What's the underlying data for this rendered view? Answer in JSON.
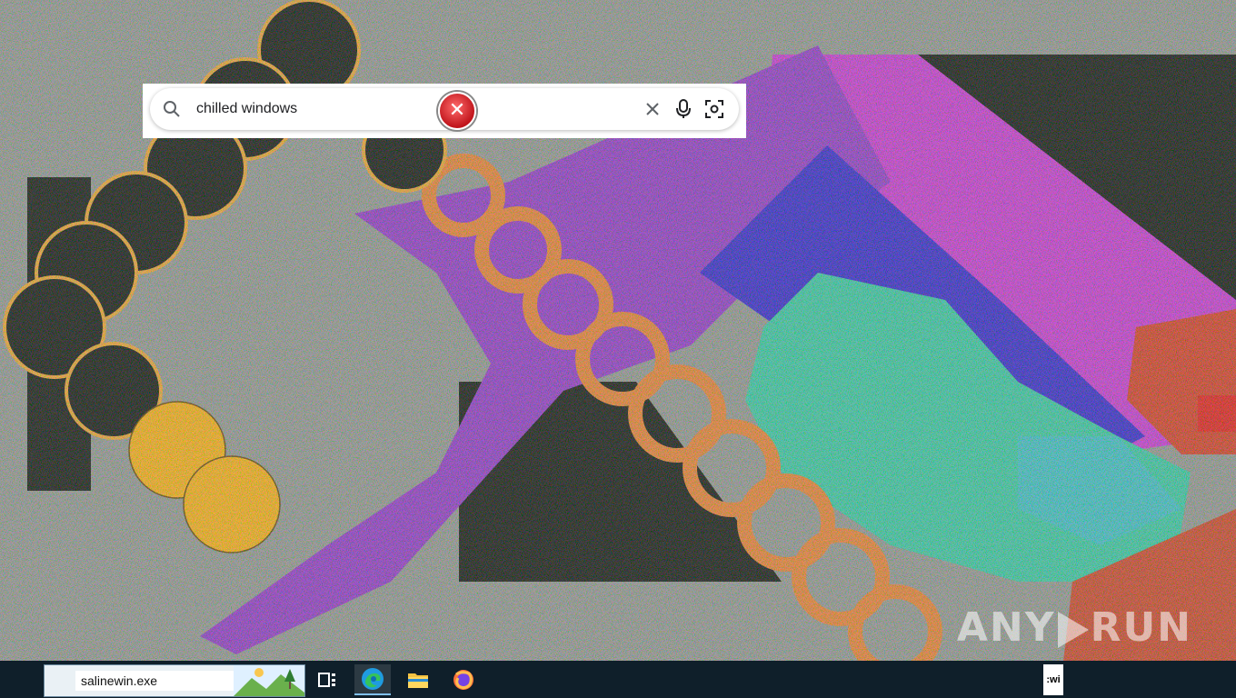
{
  "search": {
    "query": "chilled windows",
    "clear_icon": "close-icon",
    "mic_icon": "microphone-icon",
    "lens_icon": "camera-search-icon"
  },
  "error_popup": {
    "icon": "error-icon"
  },
  "watermark": {
    "text_left": "ANY",
    "text_right": "RUN"
  },
  "taskbar": {
    "search_value": "salinewin.exe",
    "pinned": [
      {
        "name": "task-view",
        "icon": "task-view-icon"
      },
      {
        "name": "edge",
        "icon": "edge-icon"
      },
      {
        "name": "file-explorer",
        "icon": "folder-icon"
      },
      {
        "name": "firefox",
        "icon": "firefox-icon"
      }
    ],
    "tray_label": ":wi"
  },
  "colors": {
    "taskbar_bg": "#0f1f2a",
    "purple": "#9b2fc9",
    "magenta": "#c42bd0",
    "blue": "#2a16c8",
    "teal": "#2fc7a3",
    "orange": "#e8782a",
    "red": "#d4321e",
    "gold": "#f5a50a"
  }
}
